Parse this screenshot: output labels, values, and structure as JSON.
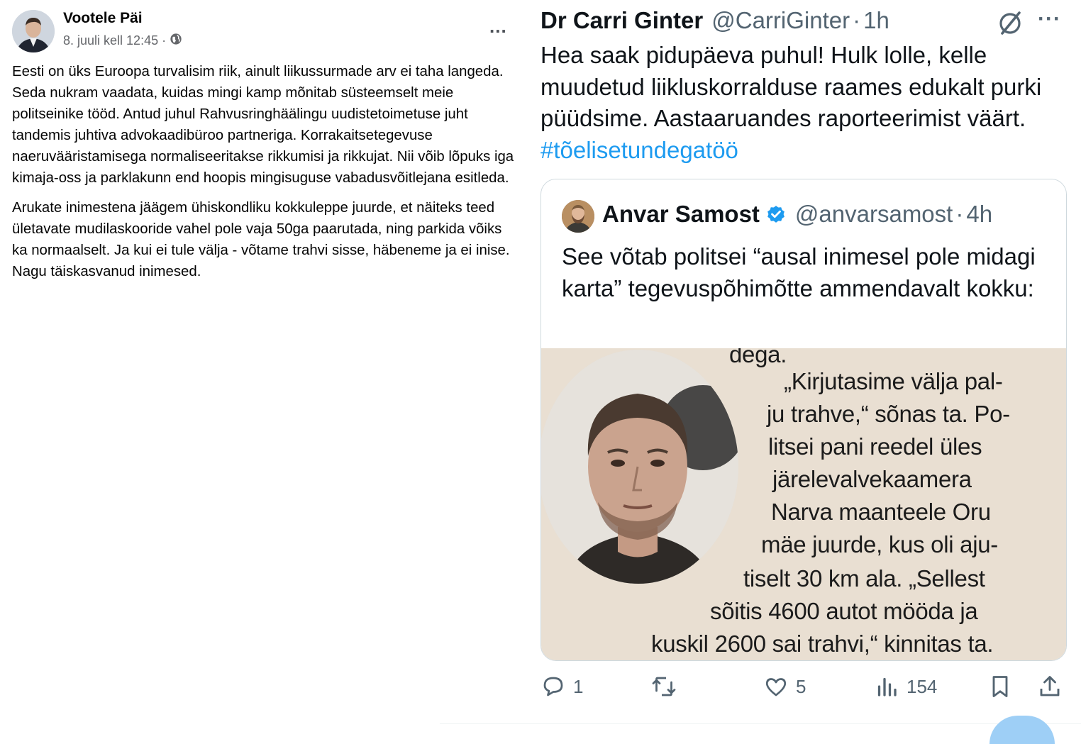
{
  "facebook": {
    "author": "Vootele Päi",
    "date": "8. juuli kell 12:45",
    "date_separator": "·",
    "more_label": "...",
    "paragraphs": [
      "Eesti on üks Euroopa turvalisim riik, ainult liikussurmade arv ei taha langeda. Seda nukram vaadata, kuidas mingi kamp mõnitab süsteemselt meie politseinike tööd. Antud juhul Rahvusringhäälingu uudistetoimetuse juht tandemis juhtiva advokaadibüroo partneriga. Korrakaitsetegevuse naeruvääristamisega normaliseeritakse rikkumisi ja rikkujat. Nii võib lõpuks iga kimaja-oss ja parklakunn end hoopis mingisuguse vabadusvõitlejana esitleda.",
      "Arukate inimestena jäägem ühiskondliku kokkuleppe juurde, et näiteks teed ületavate mudilaskooride vahel pole vaja 50ga paarutada, ning parkida võiks ka normaalselt. Ja kui ei tule välja - võtame trahvi sisse, häbeneme ja ei inise. Nagu täiskasvanud inimesed."
    ]
  },
  "tweet": {
    "author": "Dr Carri Ginter",
    "handle": "@CarriGinter",
    "separator": "·",
    "time": "1h",
    "more_label": "···",
    "text": "Hea saak pidupäeva puhul! Hulk lolle, kelle muudetud liikluskorralduse raames edukalt purki püüdsime. Aastaaruandes raporteerimist väärt. ",
    "hashtag": "#tõelisetundegatöö",
    "quote": {
      "author": "Anvar Samost",
      "handle": "@anvarsamost",
      "separator": "·",
      "time": "4h",
      "text": "See võtab politsei “ausal inimesel pole midagi karta” tegevuspõhimõtte ammendavalt kokku:",
      "clipping_lines": [
        "dega.",
        "„Kirjutasime välja pal-",
        "ju trahve,“ sõnas ta. Po-",
        "litsei pani reedel üles",
        "järelevalvekaamera",
        "Narva maanteele Oru",
        "mäe juurde, kus oli aju-",
        "tiselt 30 km ala. „Sellest",
        "sõitis 4600 autot mööda ja",
        "kuskil 2600 sai trahvi,“ kinnitas ta."
      ]
    },
    "stats": {
      "replies": "1",
      "reposts": "",
      "likes": "5",
      "views": "154"
    },
    "colors": {
      "hashtag": "#1d9bf0",
      "verified": "#1d9bf0",
      "secondary_text": "#536471"
    }
  },
  "icons": [
    "globe-icon",
    "grok-icon",
    "verified-badge-icon",
    "reply-icon",
    "repost-icon",
    "like-icon",
    "views-icon",
    "bookmark-icon",
    "share-icon"
  ]
}
